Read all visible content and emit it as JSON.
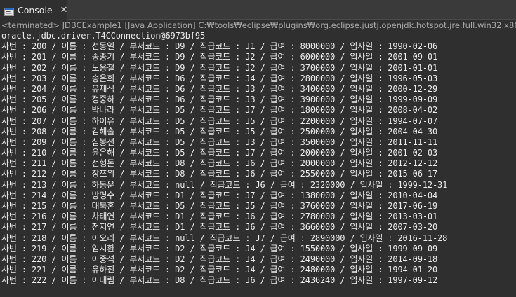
{
  "tab": {
    "label": "Console",
    "close_glyph": "✕",
    "icon": "console-icon"
  },
  "description": "<terminated> JDBCExample1 [Java Application] C:₩tools₩eclipse₩plugins₩org.eclipse.justj.openjdk.hotspot.jre.full.win32.x86_64_21.0.5",
  "colors": {
    "background": "#2f2f2f",
    "text": "#ececec",
    "description": "#a8a8a8",
    "icon_accent": "#2a6cc4"
  },
  "output_lines": [
    "oracle.jdbc.driver.T4CConnection@6973bf95",
    "사번 : 200 / 이름 : 선동일 / 부서코드 : D9 / 직급코드 : J1 / 급여 : 8000000 / 입사일 : 1990-02-06",
    "사번 : 201 / 이름 : 송종기 / 부서코드 : D9 / 직급코드 : J2 / 급여 : 6000000 / 입사일 : 2001-09-01",
    "사번 : 202 / 이름 : 노옹철 / 부서코드 : D9 / 직급코드 : J2 / 급여 : 3700000 / 입사일 : 2001-01-01",
    "사번 : 203 / 이름 : 송은희 / 부서코드 : D6 / 직급코드 : J4 / 급여 : 2800000 / 입사일 : 1996-05-03",
    "사번 : 204 / 이름 : 유재식 / 부서코드 : D6 / 직급코드 : J3 / 급여 : 3400000 / 입사일 : 2000-12-29",
    "사번 : 205 / 이름 : 정중하 / 부서코드 : D6 / 직급코드 : J3 / 급여 : 3900000 / 입사일 : 1999-09-09",
    "사번 : 206 / 이름 : 박나라 / 부서코드 : D5 / 직급코드 : J7 / 급여 : 1800000 / 입사일 : 2008-04-02",
    "사번 : 207 / 이름 : 하이유 / 부서코드 : D5 / 직급코드 : J5 / 급여 : 2200000 / 입사일 : 1994-07-07",
    "사번 : 208 / 이름 : 김해술 / 부서코드 : D5 / 직급코드 : J5 / 급여 : 2500000 / 입사일 : 2004-04-30",
    "사번 : 209 / 이름 : 심봉선 / 부서코드 : D5 / 직급코드 : J3 / 급여 : 3500000 / 입사일 : 2011-11-11",
    "사번 : 210 / 이름 : 윤은해 / 부서코드 : D5 / 직급코드 : J7 / 급여 : 2000000 / 입사일 : 2001-02-03",
    "사번 : 211 / 이름 : 전형돈 / 부서코드 : D8 / 직급코드 : J6 / 급여 : 2000000 / 입사일 : 2012-12-12",
    "사번 : 212 / 이름 : 장쯔위 / 부서코드 : D8 / 직급코드 : J6 / 급여 : 2550000 / 입사일 : 2015-06-17",
    "사번 : 213 / 이름 : 하동운 / 부서코드 : null / 직급코드 : J6 / 급여 : 2320000 / 입사일 : 1999-12-31",
    "사번 : 214 / 이름 : 방명수 / 부서코드 : D1 / 직급코드 : J7 / 급여 : 1380000 / 입사일 : 2010-04-04",
    "사번 : 215 / 이름 : 대북혼 / 부서코드 : D5 / 직급코드 : J5 / 급여 : 3760000 / 입사일 : 2017-06-19",
    "사번 : 216 / 이름 : 차태연 / 부서코드 : D1 / 직급코드 : J6 / 급여 : 2780000 / 입사일 : 2013-03-01",
    "사번 : 217 / 이름 : 전지연 / 부서코드 : D1 / 직급코드 : J6 / 급여 : 3660000 / 입사일 : 2007-03-20",
    "사번 : 218 / 이름 : 이오리 / 부서코드 : null / 직급코드 : J7 / 급여 : 2890000 / 입사일 : 2016-11-28",
    "사번 : 219 / 이름 : 임시환 / 부서코드 : D2 / 직급코드 : J4 / 급여 : 1550000 / 입사일 : 1999-09-09",
    "사번 : 220 / 이름 : 이중석 / 부서코드 : D2 / 직급코드 : J4 / 급여 : 2490000 / 입사일 : 2014-09-18",
    "사번 : 221 / 이름 : 유하진 / 부서코드 : D2 / 직급코드 : J4 / 급여 : 2480000 / 입사일 : 1994-01-20",
    "사번 : 222 / 이름 : 이태림 / 부서코드 : D8 / 직급코드 : J6 / 급여 : 2436240 / 입사일 : 1997-09-12"
  ]
}
